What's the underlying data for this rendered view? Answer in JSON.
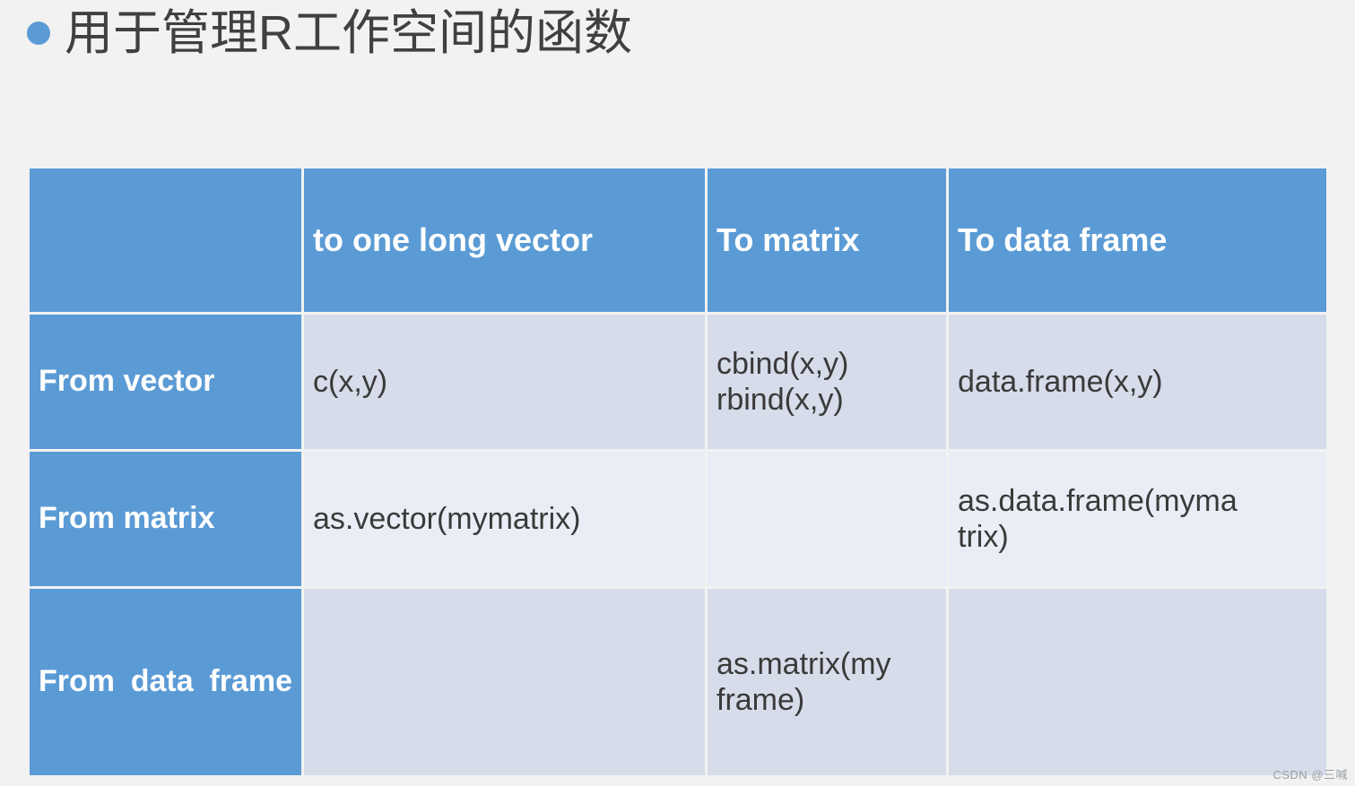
{
  "slide": {
    "title": "用于管理R工作空间的函数",
    "bullet_color": "#5B9BD5",
    "background_color": "#F2F2F2"
  },
  "table": {
    "header_fill": "#5B9BD5",
    "band_dark": "#D6DCE9",
    "band_light": "#E9EDF5",
    "columns": [
      {
        "key": "corner",
        "label": ""
      },
      {
        "key": "to_vector",
        "label": "to one long vector"
      },
      {
        "key": "to_matrix",
        "label": "To matrix"
      },
      {
        "key": "to_data_frame",
        "label": "To data frame"
      }
    ],
    "rows": [
      {
        "header": "From vector",
        "to_vector": [
          "c(x,y)"
        ],
        "to_matrix": [
          "cbind(x,y)",
          "rbind(x,y)"
        ],
        "to_data_frame": [
          "data.frame(x,y)"
        ]
      },
      {
        "header": "From matrix",
        "to_vector": [
          "as.vector(mymatrix)"
        ],
        "to_matrix": [],
        "to_data_frame": [
          "as.data.frame(myma",
          "trix)"
        ]
      },
      {
        "header": "From      data frame",
        "to_vector": [],
        "to_matrix": [
          "as.matrix(my",
          "frame)"
        ],
        "to_data_frame": []
      }
    ]
  },
  "watermark": {
    "text": "CSDN @三喊"
  }
}
